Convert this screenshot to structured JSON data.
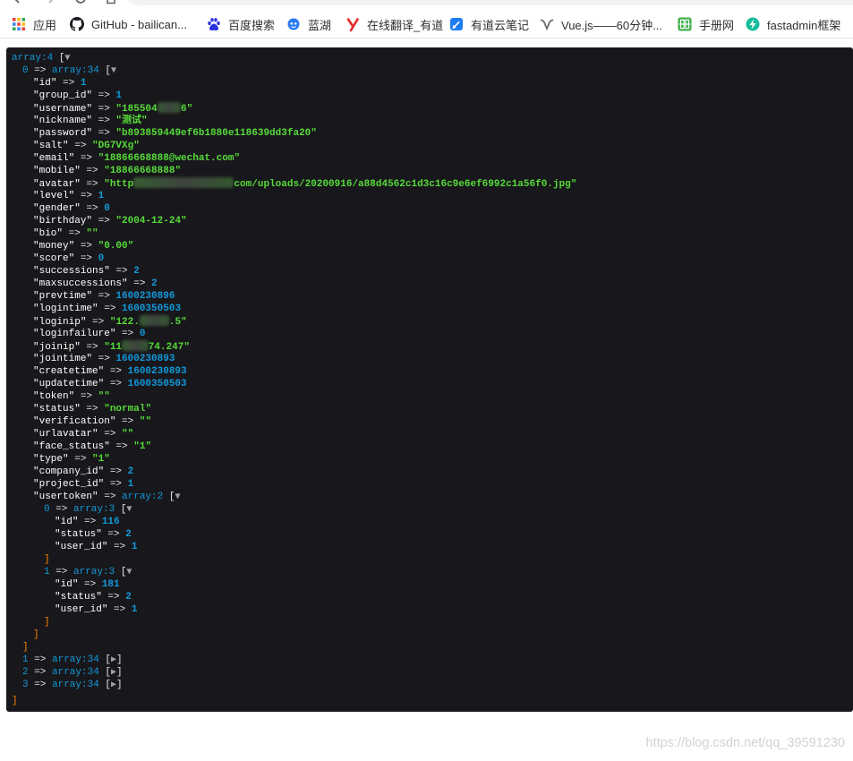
{
  "theme": {
    "dump_background": "#18171B",
    "key": "#FFFFFF",
    "punctuation": "#E6E6E6",
    "number": "#1299DA",
    "string": "#56DB3A",
    "note": "#1299DA",
    "index": "#1299DA",
    "closing_bracket": "#FF8400",
    "toggle": "#A0A0A0"
  },
  "toolbar": {
    "icons": [
      "back-icon",
      "forward-icon",
      "reload-icon",
      "home-icon"
    ]
  },
  "bookmarks": [
    {
      "label": "应用",
      "icon": "apps-grid-icon"
    },
    {
      "label": "GitHub - bailican...",
      "icon": "github-icon"
    },
    {
      "label": "百度搜索",
      "icon": "baidu-paw-icon"
    },
    {
      "label": "蓝湖",
      "icon": "lanhu-icon"
    },
    {
      "label": "在线翻译_有道",
      "icon": "youdao-icon"
    },
    {
      "label": "有道云笔记",
      "icon": "youdao-note-icon"
    },
    {
      "label": "Vue.js——60分钟...",
      "icon": "vue-page-icon"
    },
    {
      "label": "手册网",
      "icon": "shouce-icon"
    },
    {
      "label": "fastadmin框架",
      "icon": "fastadmin-icon"
    }
  ],
  "syntax": {
    "arrow": "=>",
    "open": "[",
    "close": "]",
    "expanded": "▼",
    "collapsed": "▶"
  },
  "dump": {
    "root": {
      "note": "array:4",
      "expanded": true,
      "items": [
        {
          "index": "0",
          "note": "array:34",
          "expanded": true,
          "entries": [
            {
              "key": "id",
              "type": "num",
              "value": 1
            },
            {
              "key": "group_id",
              "type": "num",
              "value": 1
            },
            {
              "key": "username",
              "type": "str",
              "parts": [
                {
                  "text": "185504"
                },
                {
                  "redacted": true
                },
                {
                  "text": "6"
                }
              ]
            },
            {
              "key": "nickname",
              "type": "str",
              "value": "测试"
            },
            {
              "key": "password",
              "type": "str",
              "value": "b893859449ef6b1880e118639dd3fa20"
            },
            {
              "key": "salt",
              "type": "str",
              "value": "DG7VXg"
            },
            {
              "key": "email",
              "type": "str",
              "value": "18866668888@wechat.com"
            },
            {
              "key": "mobile",
              "type": "str",
              "value": "18866668888"
            },
            {
              "key": "avatar",
              "type": "str",
              "parts": [
                {
                  "text": "http"
                },
                {
                  "redacted": true
                },
                {
                  "text": "com/uploads/20200916/a88d4562c1d3c16c9e6ef6992c1a56f0.jpg"
                }
              ]
            },
            {
              "key": "level",
              "type": "num",
              "value": 1
            },
            {
              "key": "gender",
              "type": "num",
              "value": 0
            },
            {
              "key": "birthday",
              "type": "str",
              "value": "2004-12-24"
            },
            {
              "key": "bio",
              "type": "str",
              "value": ""
            },
            {
              "key": "money",
              "type": "str",
              "value": "0.00"
            },
            {
              "key": "score",
              "type": "num",
              "value": 0
            },
            {
              "key": "successions",
              "type": "num",
              "value": 2
            },
            {
              "key": "maxsuccessions",
              "type": "num",
              "value": 2
            },
            {
              "key": "prevtime",
              "type": "num",
              "value": 1600230896
            },
            {
              "key": "logintime",
              "type": "num",
              "value": 1600350503
            },
            {
              "key": "loginip",
              "type": "str",
              "parts": [
                {
                  "text": "122."
                },
                {
                  "redacted": true
                },
                {
                  "text": ".5"
                }
              ]
            },
            {
              "key": "loginfailure",
              "type": "num",
              "value": 0
            },
            {
              "key": "joinip",
              "type": "str",
              "parts": [
                {
                  "text": "11"
                },
                {
                  "redacted": true
                },
                {
                  "text": "74.247"
                }
              ]
            },
            {
              "key": "jointime",
              "type": "num",
              "value": 1600230893
            },
            {
              "key": "createtime",
              "type": "num",
              "value": 1600230893
            },
            {
              "key": "updatetime",
              "type": "num",
              "value": 1600350503
            },
            {
              "key": "token",
              "type": "str",
              "value": ""
            },
            {
              "key": "status",
              "type": "str",
              "value": "normal"
            },
            {
              "key": "verification",
              "type": "str",
              "value": ""
            },
            {
              "key": "urlavatar",
              "type": "str",
              "value": ""
            },
            {
              "key": "face_status",
              "type": "str",
              "value": "1"
            },
            {
              "key": "type",
              "type": "str",
              "value": "1"
            },
            {
              "key": "company_id",
              "type": "num",
              "value": 2
            },
            {
              "key": "project_id",
              "type": "num",
              "value": 1
            },
            {
              "key": "usertoken",
              "type": "array",
              "note": "array:2",
              "expanded": true,
              "items": [
                {
                  "index": "0",
                  "note": "array:3",
                  "expanded": true,
                  "entries": [
                    {
                      "key": "id",
                      "type": "num",
                      "value": 116
                    },
                    {
                      "key": "status",
                      "type": "num",
                      "value": 2
                    },
                    {
                      "key": "user_id",
                      "type": "num",
                      "value": 1
                    }
                  ]
                },
                {
                  "index": "1",
                  "note": "array:3",
                  "expanded": true,
                  "entries": [
                    {
                      "key": "id",
                      "type": "num",
                      "value": 181
                    },
                    {
                      "key": "status",
                      "type": "num",
                      "value": 2
                    },
                    {
                      "key": "user_id",
                      "type": "num",
                      "value": 1
                    }
                  ]
                }
              ]
            }
          ]
        },
        {
          "index": "1",
          "note": "array:34",
          "expanded": false
        },
        {
          "index": "2",
          "note": "array:34",
          "expanded": false
        },
        {
          "index": "3",
          "note": "array:34",
          "expanded": false
        }
      ]
    }
  },
  "watermark": {
    "text": "https://blog.csdn.net/qq_39591230"
  }
}
